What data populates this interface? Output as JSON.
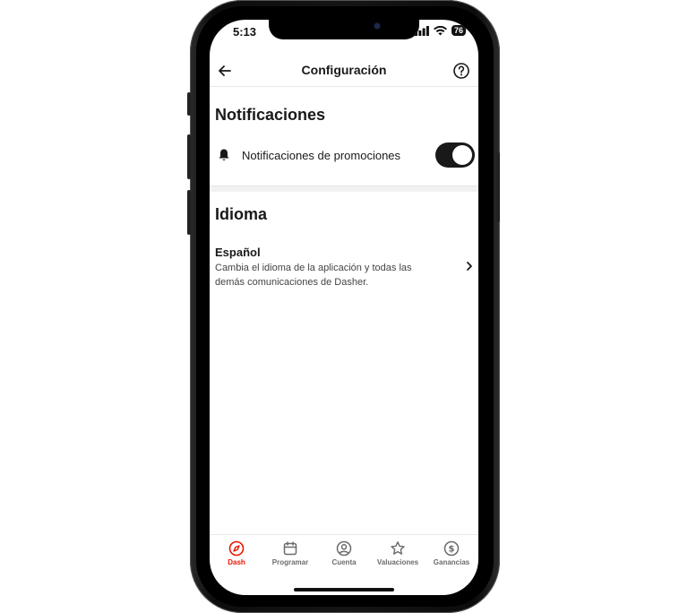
{
  "status": {
    "time": "5:13",
    "battery": "76"
  },
  "header": {
    "title": "Configuración"
  },
  "notifications": {
    "heading": "Notificaciones",
    "promo_label": "Notificaciones de promociones",
    "promo_enabled": true
  },
  "language": {
    "heading": "Idioma",
    "current": "Español",
    "description": "Cambia el idioma de la aplicación y todas las demás comunicaciones de Dasher."
  },
  "tabs": [
    {
      "label": "Dash",
      "icon": "compass-icon",
      "active": true
    },
    {
      "label": "Programar",
      "icon": "calendar-icon",
      "active": false
    },
    {
      "label": "Cuenta",
      "icon": "person-circle-icon",
      "active": false
    },
    {
      "label": "Valuaciones",
      "icon": "star-icon",
      "active": false
    },
    {
      "label": "Ganancias",
      "icon": "dollar-circle-icon",
      "active": false
    }
  ],
  "colors": {
    "accent": "#eb1700",
    "toggle_on": "#191919",
    "text": "#191919"
  }
}
